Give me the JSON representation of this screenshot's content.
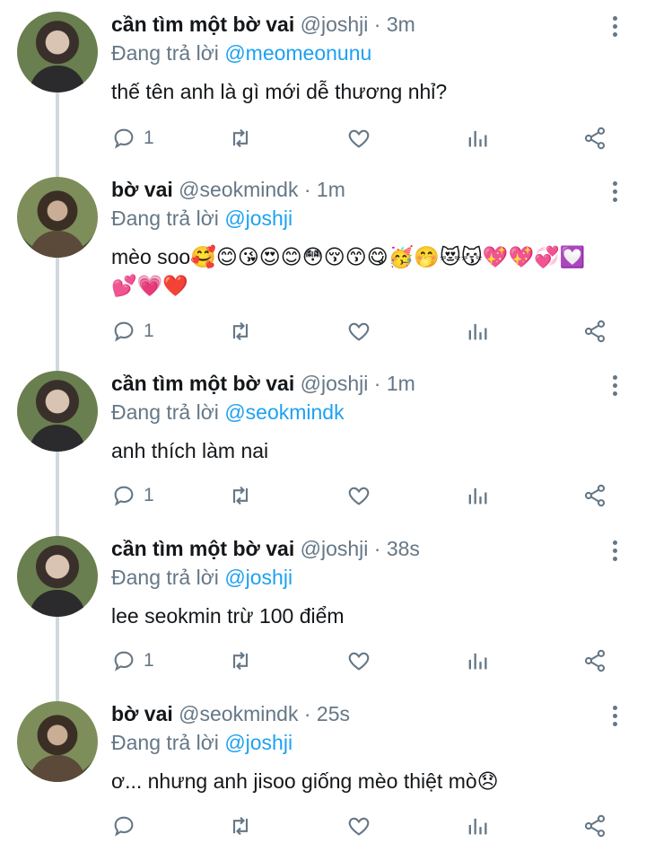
{
  "tweets": [
    {
      "name": "cần tìm một bờ vai",
      "handle": "@joshji",
      "dot": "·",
      "time": "3m",
      "reply_prefix": "Đang trả lời",
      "reply_to": "@meomeonunu",
      "text": "thế tên anh là gì mới dễ thương nhỉ?",
      "reply_count": "1",
      "avatar": "avatar-boy-dark-jacket"
    },
    {
      "name": "bờ vai",
      "handle": "@seokmindk",
      "dot": "·",
      "time": "1m",
      "reply_prefix": "Đang trả lời",
      "reply_to": "@joshji",
      "text": "mèo soo🥰😊😘😍😊😳😚😙😋🥳🤭😻😽💖💖💞💟💕💗❤️",
      "reply_count": "1",
      "avatar": "avatar-boy-outdoor"
    },
    {
      "name": "cần tìm một bờ vai",
      "handle": "@joshji",
      "dot": "·",
      "time": "1m",
      "reply_prefix": "Đang trả lời",
      "reply_to": "@seokmindk",
      "text": "anh thích làm nai",
      "reply_count": "1",
      "avatar": "avatar-boy-dark-jacket"
    },
    {
      "name": "cần tìm một bờ vai",
      "handle": "@joshji",
      "dot": "·",
      "time": "38s",
      "reply_prefix": "Đang trả lời",
      "reply_to": "@joshji",
      "text": "lee seokmin trừ 100 điểm",
      "reply_count": "1",
      "avatar": "avatar-boy-dark-jacket"
    },
    {
      "name": "bờ vai",
      "handle": "@seokmindk",
      "dot": "·",
      "time": "25s",
      "reply_prefix": "Đang trả lời",
      "reply_to": "@joshji",
      "text": "ơ... nhưng anh jisoo giống mèo thiệt mò😞",
      "reply_count": "",
      "avatar": "avatar-boy-outdoor"
    }
  ],
  "colors": {
    "accent": "#1da1f2",
    "muted": "#657786",
    "thread_line": "#cfd9de"
  },
  "icons": [
    "reply-icon",
    "retweet-icon",
    "like-icon",
    "analytics-icon",
    "share-icon",
    "more-icon"
  ]
}
